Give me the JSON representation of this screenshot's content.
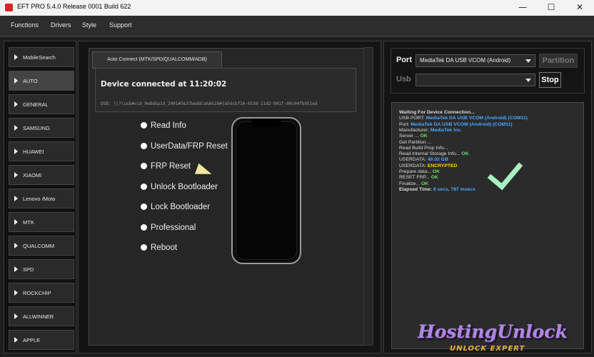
{
  "window": {
    "title": "EFT PRO 5.4.0 Release 0001 Build 622",
    "minimize": "—",
    "maximize": "☐",
    "close": "✕"
  },
  "menu": [
    "Functions",
    "Drivers",
    "Style",
    "Support"
  ],
  "sidebar": {
    "items": [
      "MobileSearch",
      "AUTO",
      "GENERAL",
      "SAMSUNG",
      "HUAWEI",
      "XIAOMI",
      "Lenovo /Moto",
      "MTK",
      "QUALCOMM",
      "SPD",
      "ROCKCHIP",
      "ALLWINNER",
      "APPLE"
    ],
    "active": "AUTO"
  },
  "center": {
    "tab_label": "Auto Connect (MTK/SPD/QUALCOMM/ADB)",
    "device_title": "Device connected at 11:20:02",
    "usb_path": "USB: \\\\?\\usb#vid_0e8d&pid_2001#5&37beddca&0&10#{a5dcbf10-6530-11d2-901f-00c04fb951ed",
    "operations": [
      "Read Info",
      "UserData/FRP Reset",
      "FRP Reset",
      "Unlock Bootloader",
      "Lock Bootloader",
      "Professional",
      "Reboot"
    ]
  },
  "port_panel": {
    "port_label": "Port",
    "port_value": "MediaTek DA USB VCOM (Android)",
    "partition_button": "Partition",
    "usb_label": "Usb",
    "usb_value": "",
    "stop_button": "Stop"
  },
  "log": {
    "lines": [
      {
        "text": "Waiting For Device Connection...",
        "value": "",
        "bold": true,
        "color": "#e0e0e0"
      },
      {
        "text": "USB PORT: ",
        "value": "MediaTek DA USB VCOM (Android) (COM11)",
        "bold": false,
        "color": "#4aa8ff"
      },
      {
        "text": "Port: ",
        "value": "MediaTek DA USB VCOM (Android) (COM11)",
        "bold": false,
        "color": "#4aa8ff"
      },
      {
        "text": "Manufacturer: ",
        "value": "MediaTek Inc.",
        "bold": false,
        "color": "#4aa8ff"
      },
      {
        "text": "Server ... ",
        "value": "OK",
        "bold": false,
        "color": "#66dd66"
      },
      {
        "text": "Get Partition ...",
        "value": "",
        "bold": false,
        "color": "#e0e0e0"
      },
      {
        "text": "Read Build Prop Info...",
        "value": "",
        "bold": false,
        "color": "#e0e0e0"
      },
      {
        "text": "Read Internal Storage Info... ",
        "value": "OK",
        "bold": false,
        "color": "#66dd66"
      },
      {
        "text": "USERDATA: ",
        "value": "49.02 GB",
        "bold": false,
        "color": "#4aa8ff"
      },
      {
        "text": "USERDATA: ",
        "value": "ENCRYPTED",
        "bold": false,
        "color": "#ffd700"
      },
      {
        "text": "Prepare data... ",
        "value": "OK",
        "bold": false,
        "color": "#66dd66"
      },
      {
        "text": "RESET FRP... ",
        "value": "OK",
        "bold": false,
        "color": "#66dd66"
      },
      {
        "text": "Finalize... ",
        "value": "OK",
        "bold": false,
        "color": "#66dd66"
      },
      {
        "text": "Elapsed Time: ",
        "value": "8 secs, 787 msecs",
        "bold": true,
        "color": "#4aa8ff"
      }
    ]
  },
  "watermark": {
    "main": "HostingUnlock",
    "sub": "UNLOCK EXPERT"
  },
  "colors": {
    "background": "#1e1e1e",
    "panel": "#2b2b2b",
    "accent_blue": "#4aa8ff",
    "ok_green": "#66dd66",
    "warning_yellow": "#ffd700"
  },
  "icons": {
    "app": "eft-app-icon",
    "check": "check-icon",
    "cursor": "mouse-cursor-icon",
    "phone": "phone-illustration"
  }
}
